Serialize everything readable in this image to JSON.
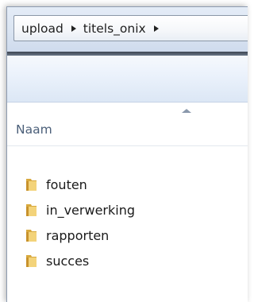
{
  "breadcrumb": {
    "items": [
      "upload",
      "titels_onix"
    ]
  },
  "columns": {
    "name_header": "Naam"
  },
  "files": [
    {
      "name": "fouten",
      "icon": "folder-icon"
    },
    {
      "name": "in_verwerking",
      "icon": "folder-icon"
    },
    {
      "name": "rapporten",
      "icon": "folder-icon"
    },
    {
      "name": "succes",
      "icon": "folder-icon"
    }
  ]
}
